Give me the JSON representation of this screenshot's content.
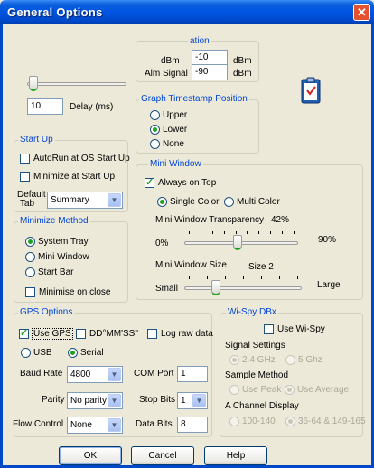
{
  "window": {
    "title": "General Options",
    "close_glyph": "✕"
  },
  "top_left": {
    "delay_value": "10",
    "delay_label": "Delay (ms)"
  },
  "alarm": {
    "legend": "ation",
    "row1_label": "dBm",
    "row1_value": "-10",
    "row1_unit": "dBm",
    "row2_label": "Alm Signal",
    "row2_value": "-90",
    "row2_unit": "dBm"
  },
  "timestamp": {
    "legend": "Graph Timestamp Position",
    "options": [
      {
        "label": "Upper",
        "selected": false
      },
      {
        "label": "Lower",
        "selected": true
      },
      {
        "label": "None",
        "selected": false
      }
    ]
  },
  "startup": {
    "legend": "Start Up",
    "autorun": "AutoRun at OS Start Up",
    "autorun_checked": false,
    "minimize": "Minimize at Start Up",
    "minimize_checked": false,
    "default_tab_label_1": "Default",
    "default_tab_label_2": "Tab",
    "default_tab_value": "Summary"
  },
  "minimize_method": {
    "legend": "Minimize Method",
    "options": [
      {
        "label": "System Tray",
        "selected": true
      },
      {
        "label": "Mini Window",
        "selected": false
      },
      {
        "label": "Start Bar",
        "selected": false
      }
    ],
    "minimise_on_close": "Minimise on close",
    "minimise_on_close_checked": false
  },
  "mini_window": {
    "legend": "Mini Window",
    "always_on_top": "Always on Top",
    "always_on_top_checked": true,
    "single_color": "Single Color",
    "multi_color": "Multi Color",
    "color_mode": "single",
    "transparency_label": "Mini Window Transparency",
    "transparency_value": "42%",
    "transparency_min": "0%",
    "transparency_max": "90%",
    "transparency_level": 42,
    "size_label": "Mini Window Size",
    "size_value": "Size 2",
    "size_min": "Small",
    "size_max": "Large",
    "size_level": 0.25
  },
  "gps": {
    "legend": "GPS Options",
    "use_gps": "Use GPS",
    "use_gps_checked": true,
    "dd_mm_ss": "DD°MM'SS\"",
    "dd_mm_ss_checked": false,
    "log_raw": "Log raw data",
    "log_raw_checked": false,
    "usb": "USB",
    "serial": "Serial",
    "connection": "serial",
    "baud_label": "Baud Rate",
    "baud_value": "4800",
    "com_label": "COM Port",
    "com_value": "1",
    "parity_label": "Parity",
    "parity_value": "No parity",
    "stop_label": "Stop Bits",
    "stop_value": "1",
    "flow_label": "Flow Control",
    "flow_value": "None",
    "data_label": "Data Bits",
    "data_value": "8"
  },
  "wispy": {
    "legend": "Wi-Spy DBx",
    "use_wispy": "Use Wi-Spy",
    "use_wispy_checked": false,
    "signal_label": "Signal  Settings",
    "band_24": "2.4 GHz",
    "band_5": "5 Ghz",
    "sample_label": "Sample Method",
    "use_peak": "Use Peak",
    "use_average": "Use Average",
    "channel_label": "A Channel Display",
    "ch_100": "100-140",
    "ch_36": "36-64 & 149-165"
  },
  "buttons": {
    "ok": "OK",
    "cancel": "Cancel",
    "help": "Help"
  },
  "colors": {
    "title_bar": "#0054e3",
    "legend": "#0046d5",
    "check": "#21a121",
    "face": "#ece9d8"
  }
}
